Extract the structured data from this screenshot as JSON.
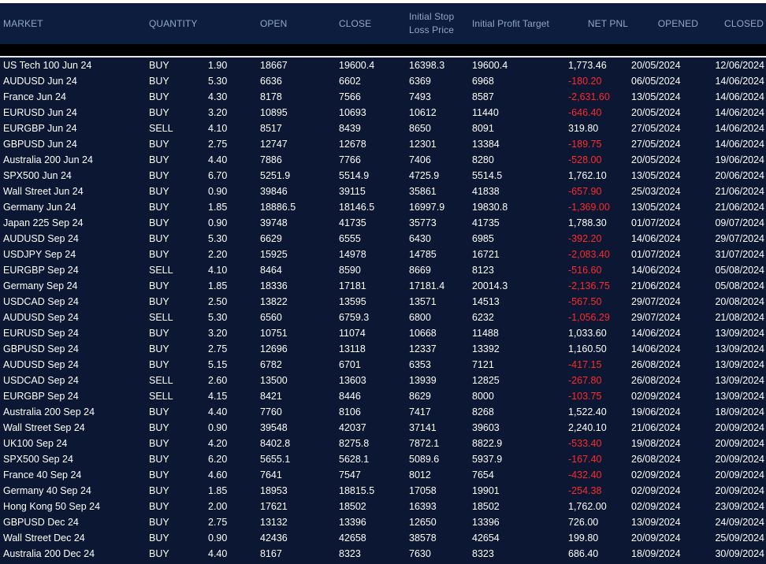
{
  "headers": {
    "market": "MARKET",
    "quantity": "QUANTITY",
    "open": "OPEN",
    "close": "CLOSE",
    "stop": "Initial Stop\nLoss Price",
    "target": "Initial Profit Target",
    "pnl": "NET PNL",
    "opened": "OPENED",
    "closed": "CLOSED"
  },
  "colors": {
    "background": "#0b1733",
    "header_text": "#8fa7c9",
    "negative": "#ff2a2a"
  },
  "rows": [
    {
      "market": "US Tech 100 Jun 24",
      "side": "BUY",
      "qty": "1.90",
      "open": "18667",
      "close": "19600.4",
      "stop": "16398.3",
      "target": "19600.4",
      "pnl": "1,773.46",
      "opened": "20/05/2024",
      "closed": "12/06/2024"
    },
    {
      "market": "AUDUSD Jun 24",
      "side": "BUY",
      "qty": "5.30",
      "open": "6636",
      "close": "6602",
      "stop": "6369",
      "target": "6968",
      "pnl": "-180.20",
      "opened": "06/05/2024",
      "closed": "14/06/2024"
    },
    {
      "market": "France Jun 24",
      "side": "BUY",
      "qty": "4.30",
      "open": "8178",
      "close": "7566",
      "stop": "7493",
      "target": "8587",
      "pnl": "-2,631.60",
      "opened": "13/05/2024",
      "closed": "14/06/2024"
    },
    {
      "market": "EURUSD Jun 24",
      "side": "BUY",
      "qty": "3.20",
      "open": "10895",
      "close": "10693",
      "stop": "10612",
      "target": "11440",
      "pnl": "-646.40",
      "opened": "20/05/2024",
      "closed": "14/06/2024"
    },
    {
      "market": "EURGBP Jun 24",
      "side": "SELL",
      "qty": "4.10",
      "open": "8517",
      "close": "8439",
      "stop": "8650",
      "target": "8091",
      "pnl": "319.80",
      "opened": "27/05/2024",
      "closed": "14/06/2024"
    },
    {
      "market": "GBPUSD Jun 24",
      "side": "BUY",
      "qty": "2.75",
      "open": "12747",
      "close": "12678",
      "stop": "12301",
      "target": "13384",
      "pnl": "-189.75",
      "opened": "27/05/2024",
      "closed": "14/06/2024"
    },
    {
      "market": "Australia 200 Jun 24",
      "side": "BUY",
      "qty": "4.40",
      "open": "7886",
      "close": "7766",
      "stop": "7406",
      "target": "8280",
      "pnl": "-528.00",
      "opened": "20/05/2024",
      "closed": "19/06/2024"
    },
    {
      "market": "SPX500 Jun 24",
      "side": "BUY",
      "qty": "6.70",
      "open": "5251.9",
      "close": "5514.9",
      "stop": "4725.9",
      "target": "5514.5",
      "pnl": "1,762.10",
      "opened": "13/05/2024",
      "closed": "20/06/2024"
    },
    {
      "market": "Wall Street Jun 24",
      "side": "BUY",
      "qty": "0.90",
      "open": "39846",
      "close": "39115",
      "stop": "35861",
      "target": "41838",
      "pnl": "-657.90",
      "opened": "25/03/2024",
      "closed": "21/06/2024"
    },
    {
      "market": "Germany Jun 24",
      "side": "BUY",
      "qty": "1.85",
      "open": "18886.5",
      "close": "18146.5",
      "stop": "16997.9",
      "target": "19830.8",
      "pnl": "-1,369.00",
      "opened": "13/05/2024",
      "closed": "21/06/2024"
    },
    {
      "market": "Japan 225 Sep 24",
      "side": "BUY",
      "qty": "0.90",
      "open": "39748",
      "close": "41735",
      "stop": "35773",
      "target": "41735",
      "pnl": "1,788.30",
      "opened": "01/07/2024",
      "closed": "09/07/2024"
    },
    {
      "market": "AUDUSD Sep 24",
      "side": "BUY",
      "qty": "5.30",
      "open": "6629",
      "close": "6555",
      "stop": "6430",
      "target": "6985",
      "pnl": "-392.20",
      "opened": "14/06/2024",
      "closed": "29/07/2024"
    },
    {
      "market": "USDJPY Sep 24",
      "side": "BUY",
      "qty": "2.20",
      "open": "15925",
      "close": "14978",
      "stop": "14785",
      "target": "16721",
      "pnl": "-2,083.40",
      "opened": "01/07/2024",
      "closed": "31/07/2024"
    },
    {
      "market": "EURGBP Sep 24",
      "side": "SELL",
      "qty": "4.10",
      "open": "8464",
      "close": "8590",
      "stop": "8669",
      "target": "8123",
      "pnl": "-516.60",
      "opened": "14/06/2024",
      "closed": "05/08/2024"
    },
    {
      "market": "Germany Sep 24",
      "side": "BUY",
      "qty": "1.85",
      "open": "18336",
      "close": "17181",
      "stop": "17181.4",
      "target": "20014.3",
      "pnl": "-2,136.75",
      "opened": "21/06/2024",
      "closed": "05/08/2024"
    },
    {
      "market": "USDCAD Sep 24",
      "side": "BUY",
      "qty": "2.50",
      "open": "13822",
      "close": "13595",
      "stop": "13571",
      "target": "14513",
      "pnl": "-567.50",
      "opened": "29/07/2024",
      "closed": "20/08/2024"
    },
    {
      "market": "AUDUSD Sep 24",
      "side": "SELL",
      "qty": "5.30",
      "open": "6560",
      "close": "6759.3",
      "stop": "6800",
      "target": "6232",
      "pnl": "-1,056.29",
      "opened": "29/07/2024",
      "closed": "21/08/2024"
    },
    {
      "market": "EURUSD Sep 24",
      "side": "BUY",
      "qty": "3.20",
      "open": "10751",
      "close": "11074",
      "stop": "10668",
      "target": "11488",
      "pnl": "1,033.60",
      "opened": "14/06/2024",
      "closed": "13/09/2024"
    },
    {
      "market": "GBPUSD Sep 24",
      "side": "BUY",
      "qty": "2.75",
      "open": "12696",
      "close": "13118",
      "stop": "12337",
      "target": "13392",
      "pnl": "1,160.50",
      "opened": "14/06/2024",
      "closed": "13/09/2024"
    },
    {
      "market": "AUDUSD Sep 24",
      "side": "BUY",
      "qty": "5.15",
      "open": "6782",
      "close": "6701",
      "stop": "6353",
      "target": "7121",
      "pnl": "-417.15",
      "opened": "26/08/2024",
      "closed": "13/09/2024"
    },
    {
      "market": "USDCAD Sep 24",
      "side": "SELL",
      "qty": "2.60",
      "open": "13500",
      "close": "13603",
      "stop": "13939",
      "target": "12825",
      "pnl": "-267.80",
      "opened": "26/08/2024",
      "closed": "13/09/2024"
    },
    {
      "market": "EURGBP Sep 24",
      "side": "SELL",
      "qty": "4.15",
      "open": "8421",
      "close": "8446",
      "stop": "8629",
      "target": "8000",
      "pnl": "-103.75",
      "opened": "02/09/2024",
      "closed": "13/09/2024"
    },
    {
      "market": "Australia 200 Sep 24",
      "side": "BUY",
      "qty": "4.40",
      "open": "7760",
      "close": "8106",
      "stop": "7417",
      "target": "8268",
      "pnl": "1,522.40",
      "opened": "19/06/2024",
      "closed": "18/09/2024"
    },
    {
      "market": "Wall Street Sep 24",
      "side": "BUY",
      "qty": "0.90",
      "open": "39548",
      "close": "42037",
      "stop": "37141",
      "target": "39603",
      "pnl": "2,240.10",
      "opened": "21/06/2024",
      "closed": "20/09/2024"
    },
    {
      "market": "UK100 Sep 24",
      "side": "BUY",
      "qty": "4.20",
      "open": "8402.8",
      "close": "8275.8",
      "stop": "7872.1",
      "target": "8822.9",
      "pnl": "-533.40",
      "opened": "19/08/2024",
      "closed": "20/09/2024"
    },
    {
      "market": "SPX500 Sep 24",
      "side": "BUY",
      "qty": "6.20",
      "open": "5655.1",
      "close": "5628.1",
      "stop": "5089.6",
      "target": "5937.9",
      "pnl": "-167.40",
      "opened": "26/08/2024",
      "closed": "20/09/2024"
    },
    {
      "market": "France 40 Sep 24",
      "side": "BUY",
      "qty": "4.60",
      "open": "7641",
      "close": "7547",
      "stop": "8012",
      "target": "7654",
      "pnl": "-432.40",
      "opened": "02/09/2024",
      "closed": "20/09/2024"
    },
    {
      "market": "Germany 40 Sep 24",
      "side": "BUY",
      "qty": "1.85",
      "open": "18953",
      "close": "18815.5",
      "stop": "17058",
      "target": "19901",
      "pnl": "-254.38",
      "opened": "02/09/2024",
      "closed": "20/09/2024"
    },
    {
      "market": "Hong Kong 50 Sep  24",
      "side": "BUY",
      "qty": "2.00",
      "open": "17621",
      "close": "18502",
      "stop": "16393",
      "target": "18502",
      "pnl": "1,762.00",
      "opened": "02/09/2024",
      "closed": "23/09/2024"
    },
    {
      "market": "GBPUSD Dec 24",
      "side": "BUY",
      "qty": "2.75",
      "open": "13132",
      "close": "13396",
      "stop": "12650",
      "target": "13396",
      "pnl": "726.00",
      "opened": "13/09/2024",
      "closed": "24/09/2024"
    },
    {
      "market": "Wall Street Dec 24",
      "side": "BUY",
      "qty": "0.90",
      "open": "42436",
      "close": "42658",
      "stop": "38578",
      "target": "42654",
      "pnl": "199.80",
      "opened": "20/09/2024",
      "closed": "25/09/2024"
    },
    {
      "market": "Australia 200 Dec 24",
      "side": "BUY",
      "qty": "4.40",
      "open": "8167",
      "close": "8323",
      "stop": "7630",
      "target": "8323",
      "pnl": "686.40",
      "opened": "18/09/2024",
      "closed": "30/09/2024"
    }
  ]
}
